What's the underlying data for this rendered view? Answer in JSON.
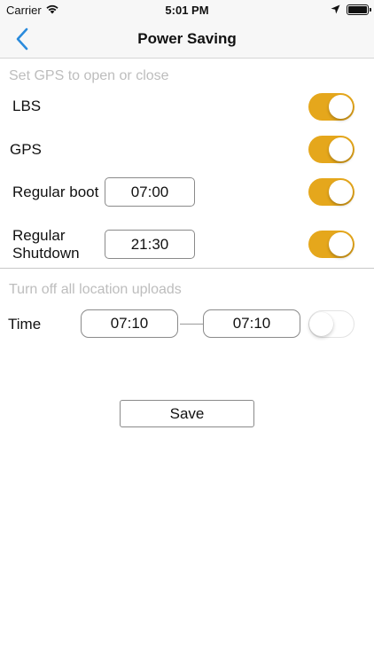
{
  "status_bar": {
    "carrier": "Carrier",
    "time": "5:01 PM",
    "icons": [
      "wifi-icon",
      "location-arrow-icon",
      "battery-icon"
    ]
  },
  "nav": {
    "title": "Power Saving",
    "back_icon": "chevron-left-icon",
    "accent_color": "#2a8bdc"
  },
  "gps_section": {
    "header": "Set GPS to open or close",
    "rows": [
      {
        "label": "LBS",
        "enabled": true
      },
      {
        "label": "GPS",
        "enabled": true
      },
      {
        "label": "Regular boot",
        "time": "07:00",
        "enabled": true
      },
      {
        "label_line1": "Regular",
        "label_line2": "Shutdown",
        "time": "21:30",
        "enabled": true
      }
    ]
  },
  "upload_section": {
    "header": "Turn off all location uploads",
    "time_label": "Time",
    "start_time": "07:10",
    "end_time": "07:10",
    "enabled": false
  },
  "save_label": "Save",
  "colors": {
    "toggle_on": "#e5a71c",
    "section_header": "#bdbdbd"
  }
}
